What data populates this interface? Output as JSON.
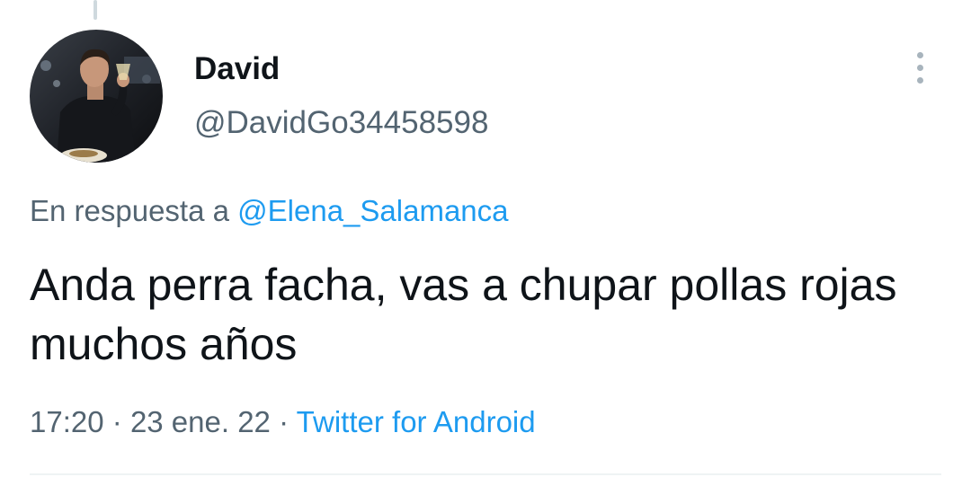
{
  "tweet": {
    "author": {
      "display_name": "David",
      "handle": "@DavidGo34458598",
      "avatar_icon": "profile-photo"
    },
    "reply_to": {
      "prefix": "En respuesta a",
      "mention": "@Elena_Salamanca"
    },
    "text": "Anda perra facha, vas a chupar pollas rojas muchos años",
    "meta": {
      "time": "17:20",
      "separator": "·",
      "date": "23 ene. 22",
      "source": "Twitter for Android"
    },
    "more_icon": "more-vertical-icon"
  },
  "colors": {
    "text_primary": "#0f1419",
    "text_secondary": "#536471",
    "link": "#1d9bf0",
    "thread_line": "#cfd9de",
    "divider": "#eff3f4"
  }
}
